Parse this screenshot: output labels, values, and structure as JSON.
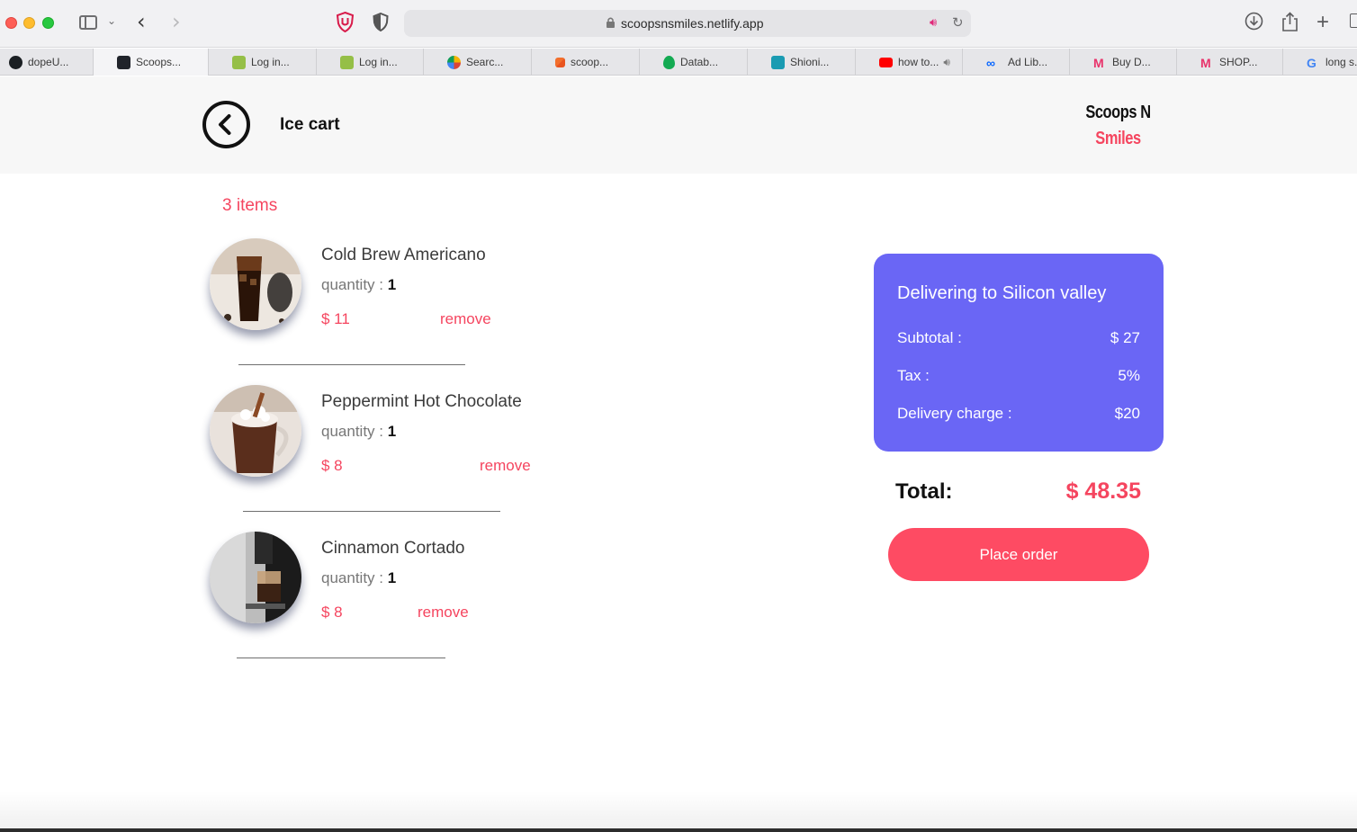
{
  "browser": {
    "url": "scoopsnsmiles.netlify.app",
    "tabs": [
      {
        "label": "dopeU...",
        "icon": "github-icon"
      },
      {
        "label": "Scoops...",
        "icon": "react-icon",
        "active": true
      },
      {
        "label": "Log in...",
        "icon": "shopify-icon"
      },
      {
        "label": "Log in...",
        "icon": "shopify-icon"
      },
      {
        "label": "Searc...",
        "icon": "search-ring-icon"
      },
      {
        "label": "scoop...",
        "icon": "netlify-icon"
      },
      {
        "label": "Datab...",
        "icon": "mongodb-icon"
      },
      {
        "label": "Shioni...",
        "icon": "s-logo-icon"
      },
      {
        "label": "how to...",
        "icon": "youtube-icon",
        "audio": true
      },
      {
        "label": "Ad Lib...",
        "icon": "meta-icon"
      },
      {
        "label": "Buy D...",
        "icon": "myntra-icon"
      },
      {
        "label": "SHOP...",
        "icon": "myntra-icon"
      },
      {
        "label": "long s...",
        "icon": "google-icon"
      }
    ]
  },
  "header": {
    "title": "Ice cart",
    "brand_line1": "Scoops N",
    "brand_line2": "Smiles"
  },
  "cart": {
    "count_label": "3 items",
    "qty_label": "quantity :",
    "remove_label": "remove",
    "items": [
      {
        "name": "Cold Brew Americano",
        "qty": "1",
        "price": "$ 11"
      },
      {
        "name": "Peppermint Hot Chocolate",
        "qty": "1",
        "price": "$ 8"
      },
      {
        "name": "Cinnamon Cortado",
        "qty": "1",
        "price": "$ 8"
      }
    ]
  },
  "summary": {
    "title": "Delivering to Silicon valley",
    "subtotal_label": "Subtotal :",
    "subtotal_value": "$ 27",
    "tax_label": "Tax :",
    "tax_value": "5%",
    "delivery_label": "Delivery charge :",
    "delivery_value": "$20",
    "total_label": "Total:",
    "total_value": "$ 48.35",
    "place_order_label": "Place order"
  },
  "colors": {
    "accent": "#f5455f",
    "summary_bg": "#6a66f5",
    "button_bg": "#fe4b63"
  }
}
